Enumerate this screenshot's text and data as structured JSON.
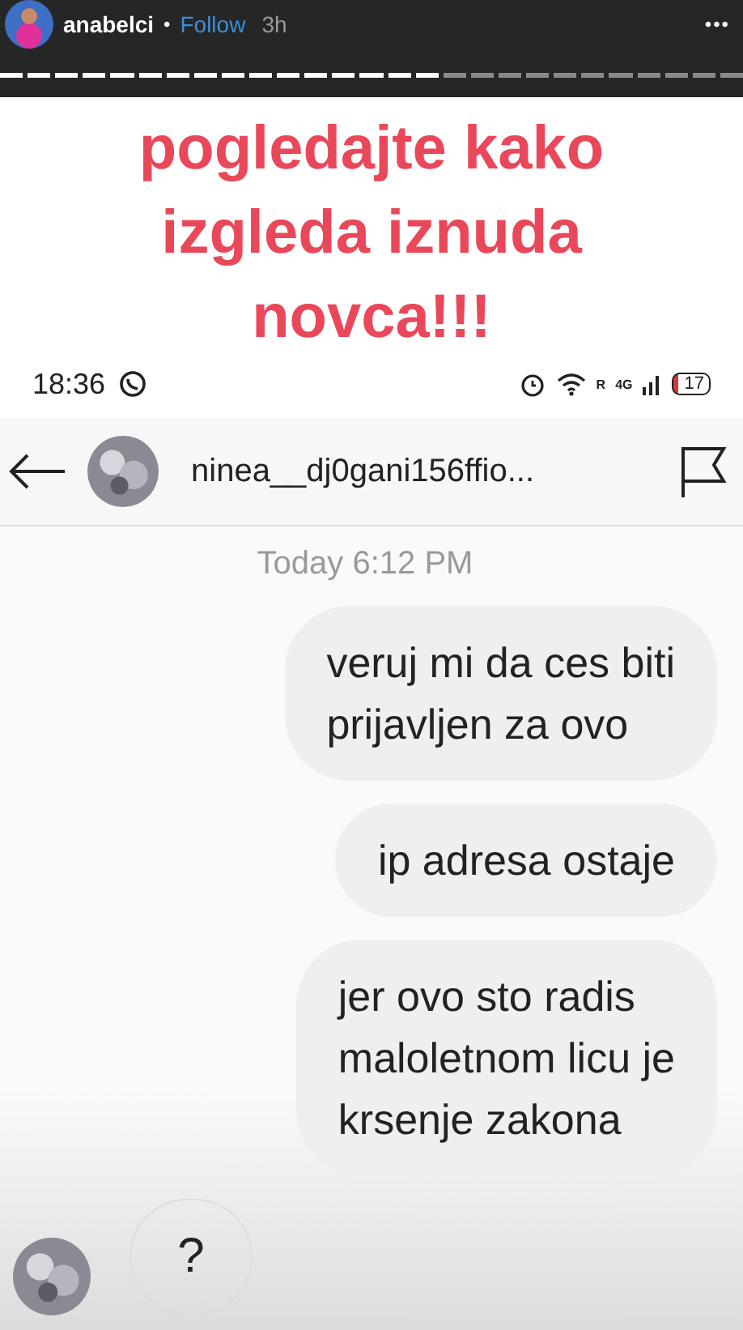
{
  "story_header": {
    "username": "anabelci",
    "separator": "•",
    "follow": "Follow",
    "time": "3h",
    "more": "•••"
  },
  "progress_segments": [
    {
      "seen": true
    },
    {
      "seen": true
    },
    {
      "seen": true
    },
    {
      "seen": true
    },
    {
      "seen": true
    },
    {
      "seen": true
    },
    {
      "seen": true
    },
    {
      "seen": true
    },
    {
      "seen": true
    },
    {
      "seen": true
    },
    {
      "seen": true
    },
    {
      "seen": true
    },
    {
      "seen": true
    },
    {
      "seen": true
    },
    {
      "seen": true
    },
    {
      "seen": true
    },
    {
      "seen": false
    },
    {
      "seen": false
    },
    {
      "seen": false
    },
    {
      "seen": false
    },
    {
      "seen": false
    },
    {
      "seen": false
    },
    {
      "seen": false
    },
    {
      "seen": false
    },
    {
      "seen": false
    },
    {
      "seen": false
    },
    {
      "seen": false
    }
  ],
  "caption": "pogledajte kako\nizgleda iznuda\nnovca!!!",
  "phone_status_bar": {
    "time": "18:36",
    "network": "4G",
    "roaming": "R",
    "battery": "17"
  },
  "chat_header": {
    "username": "ninea__dj0gani156ffio..."
  },
  "date_label": "Today 6:12 PM",
  "messages": [
    {
      "kind": "sent",
      "text": "veruj mi da ces biti\nprijavljen za ovo"
    },
    {
      "kind": "sent",
      "text": "ip adresa ostaje"
    },
    {
      "kind": "sent",
      "text": "jer ovo sto radis\nmaloletnom licu je\nkrsenje zakona"
    },
    {
      "kind": "received",
      "text": "?"
    }
  ]
}
